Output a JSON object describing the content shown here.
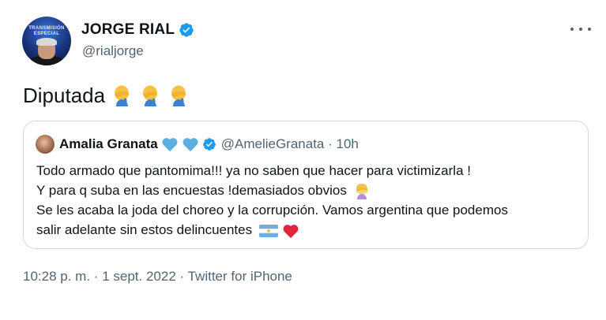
{
  "author": {
    "display_name": "JORGE RIAL",
    "handle": "@rialjorge",
    "avatar_text": "TRANSMISIÓN ESPECIAL",
    "verified": true
  },
  "tweet": {
    "text": "Diputada",
    "emoji": [
      "facepalm-icon",
      "facepalm-icon",
      "facepalm-icon"
    ]
  },
  "quote": {
    "display_name": "Amalia Granata",
    "handle_time": "@AmelieGranata · 10h",
    "lines": [
      "Todo armado que pantomima!!! ya no saben que hacer para victimizarla !",
      "Y para q suba en las encuestas !demasiados obvios",
      "Se les acaba la joda del choreo y la corrupción. Vamos argentina que podemos",
      "salir adelante sin estos delincuentes"
    ]
  },
  "meta": {
    "time": "10:28 p. m.",
    "date": "1 sept. 2022",
    "source": "Twitter for iPhone",
    "separator": "·"
  },
  "colors": {
    "text": "#0f1419",
    "secondary": "#536471",
    "verified": "#1d9bf0",
    "border": "#cfd9de",
    "blue_heart": "#5aaee0",
    "red_heart": "#e0243a"
  }
}
